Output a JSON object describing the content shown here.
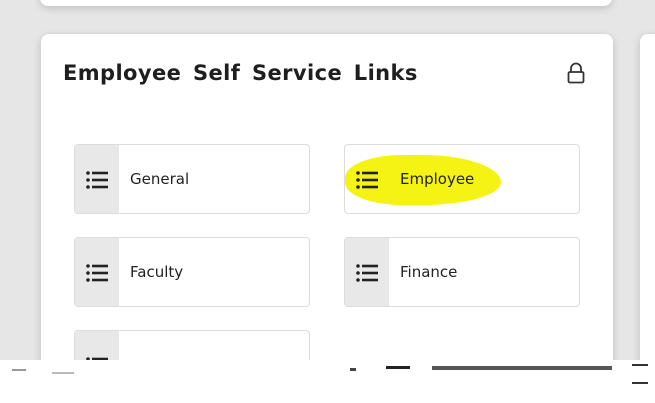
{
  "card": {
    "title": "Employee Self Service Links",
    "lock_icon": "lock-icon"
  },
  "tiles": [
    {
      "label": "General",
      "icon": "list-icon"
    },
    {
      "label": "Employee",
      "icon": "list-icon",
      "highlight_color": "#f4f200"
    },
    {
      "label": "Faculty",
      "icon": "list-icon"
    },
    {
      "label": "Finance",
      "icon": "list-icon"
    }
  ],
  "colors": {
    "background": "#e6e6e6",
    "card": "#ffffff",
    "icon_box": "#e8e8e8",
    "highlight": "#f4f200"
  }
}
